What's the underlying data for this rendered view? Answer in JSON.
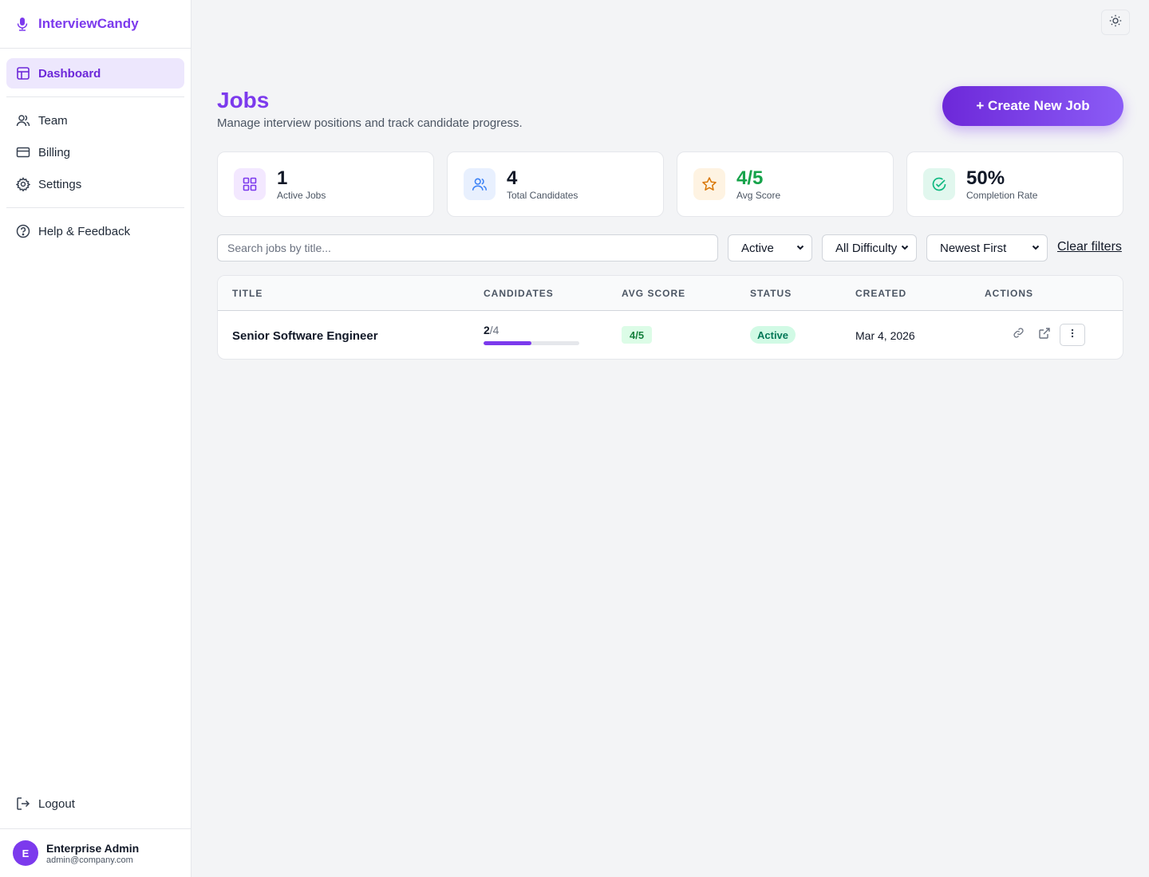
{
  "app": {
    "name": "InterviewCandy"
  },
  "sidebar": {
    "items": [
      {
        "label": "Dashboard",
        "icon": "layout-icon",
        "active": true
      },
      {
        "label": "Team",
        "icon": "users-icon"
      },
      {
        "label": "Billing",
        "icon": "credit-card-icon"
      },
      {
        "label": "Settings",
        "icon": "gear-icon"
      },
      {
        "label": "Help & Feedback",
        "icon": "help-circle-icon"
      }
    ],
    "logout_label": "Logout",
    "user": {
      "initial": "E",
      "name": "Enterprise Admin",
      "email": "admin@company.com"
    }
  },
  "header": {
    "title": "Jobs",
    "subtitle": "Manage interview positions and track candidate progress.",
    "create_label": "+ Create New Job"
  },
  "stats": [
    {
      "value": "1",
      "label": "Active Jobs",
      "icon": "grid-icon",
      "color": "#7c3aed",
      "bg": "#f3e8ff"
    },
    {
      "value": "4",
      "label": "Total Candidates",
      "icon": "users-icon",
      "color": "#3b82f6",
      "bg": "#e8f0fe"
    },
    {
      "value": "4/5",
      "label": "Avg Score",
      "icon": "star-icon",
      "color": "#d97706",
      "bg": "#fef3e2",
      "value_color": "#16a34a"
    },
    {
      "value": "50%",
      "label": "Completion Rate",
      "icon": "check-circle-icon",
      "color": "#10b981",
      "bg": "#e1f7ee"
    }
  ],
  "filters": {
    "search_placeholder": "Search jobs by title...",
    "status": "Active",
    "difficulty": "All Difficulty",
    "sort": "Newest First",
    "clear_label": "Clear filters"
  },
  "table": {
    "columns": [
      "TITLE",
      "CANDIDATES",
      "AVG SCORE",
      "STATUS",
      "CREATED",
      "ACTIONS"
    ],
    "rows": [
      {
        "title": "Senior Software Engineer",
        "candidates_done": "2",
        "candidates_total": "/4",
        "progress": 0.5,
        "avg_score": "4/5",
        "status": "Active",
        "created": "Mar 4, 2026"
      }
    ]
  },
  "colors": {
    "accent": "#7c3aed",
    "success": "#16a34a"
  }
}
